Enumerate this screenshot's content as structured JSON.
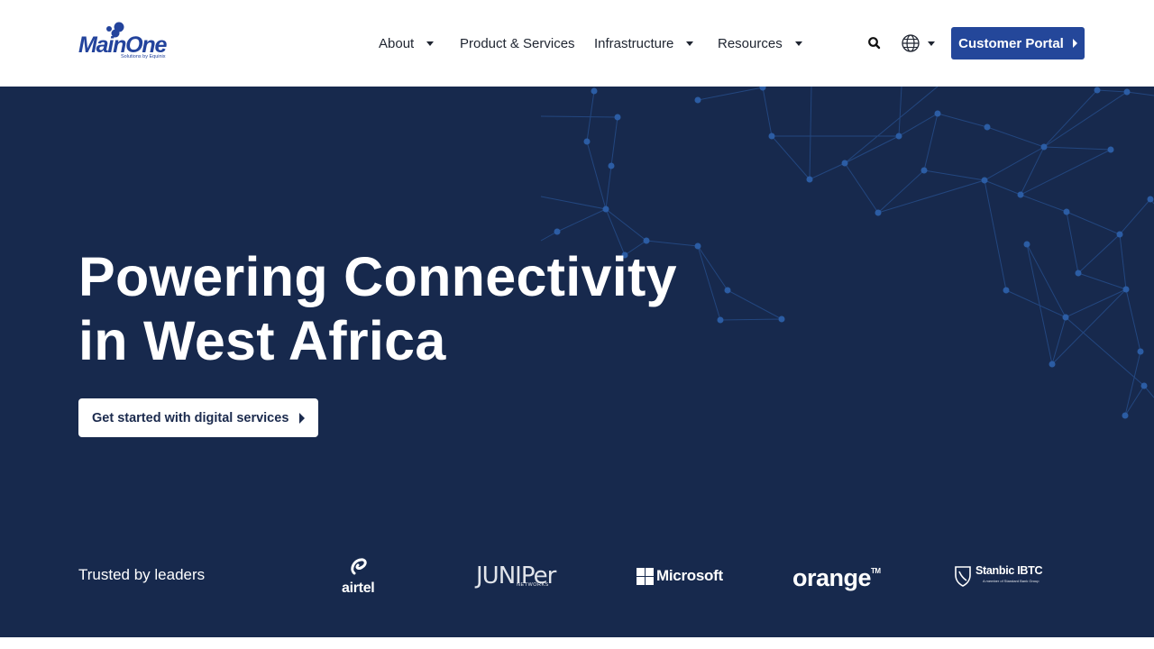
{
  "brand": {
    "name": "MainOne",
    "tagline": "Solutions by Equinix"
  },
  "nav": {
    "items": [
      {
        "label": "About",
        "has_dropdown": true
      },
      {
        "label": "Product & Services",
        "has_dropdown": false
      },
      {
        "label": "Infrastructure",
        "has_dropdown": true
      },
      {
        "label": "Resources",
        "has_dropdown": true
      }
    ],
    "search_icon": "search-icon",
    "language_icon": "globe-icon",
    "portal_button": "Customer Portal"
  },
  "hero": {
    "title_line1": "Powering Connectivity",
    "title_line2": "in West Africa",
    "cta_label": "Get started with digital services"
  },
  "trusted": {
    "label": "Trusted by leaders",
    "partners": {
      "airtel": "airtel",
      "juniper": "JUNIPer",
      "juniper_sub": "NETWORKS",
      "microsoft": "Microsoft",
      "orange": "orange",
      "orange_tm": "TM",
      "stanbic": "Stanbic IBTC",
      "stanbic_sub": "A member of Standard Bank Group"
    }
  },
  "colors": {
    "header_bg": "#ffffff",
    "hero_bg": "#17294d",
    "brand_blue": "#24479a",
    "network_lines": "#2d5fa8"
  }
}
